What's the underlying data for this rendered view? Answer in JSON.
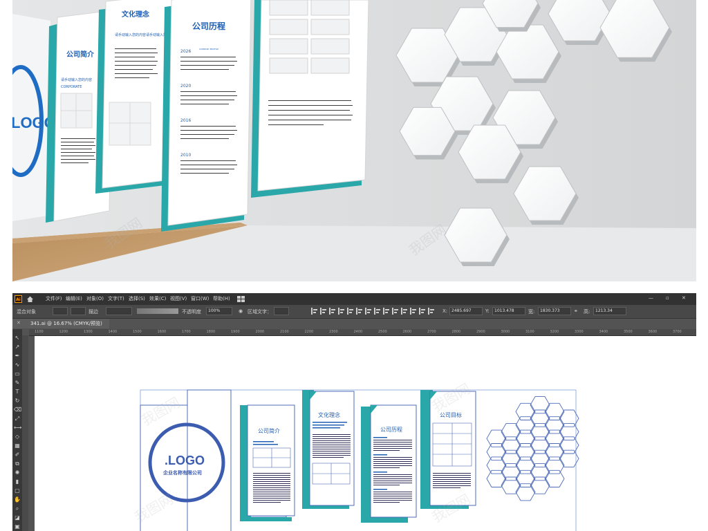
{
  "mockup": {
    "panels": [
      {
        "title": "公司简介",
        "subtitle": "请手动输入您的内容",
        "english": "CORPORATE"
      },
      {
        "title": "文化理念",
        "subtitle": "请手动输入您的内容请手动输入您的内容"
      },
      {
        "title": "公司历程",
        "years": [
          "2026",
          "2020",
          "2016",
          "2010"
        ],
        "year_caption": "COMPANY PROFILE"
      }
    ],
    "logo_text": "LOGO",
    "watermark": "我图网"
  },
  "app": {
    "logo": "Ai",
    "menu": [
      "文件(F)",
      "编辑(E)",
      "对象(O)",
      "文字(T)",
      "选择(S)",
      "效果(C)",
      "视图(V)",
      "窗口(W)",
      "帮助(H)"
    ],
    "control_bar": {
      "mode_label": "混合对象",
      "stroke_label": "描边",
      "opacity_label": "不透明度",
      "opacity_value": "100%",
      "area_text_label": "区域文字：",
      "x_label": "X:",
      "x_value": "2485.697",
      "y_label": "Y:",
      "y_value": "1013.478",
      "w_label": "宽:",
      "w_value": "1830.373",
      "h_label": "高:",
      "h_value": "1213.34"
    },
    "doc_tab": "341.ai @ 16.67% (CMYK/预览)",
    "ruler_ticks": [
      "1100",
      "1200",
      "1300",
      "1400",
      "1500",
      "1600",
      "1700",
      "1800",
      "1900",
      "2000",
      "2100",
      "2200",
      "2300",
      "2400",
      "2500",
      "2600",
      "2700",
      "2800",
      "2900",
      "3000",
      "3100",
      "3200",
      "3300",
      "3400",
      "3500",
      "3600",
      "3700"
    ]
  },
  "artboard": {
    "logo_text": ".LOGO",
    "company_name": "企业名称有限公司",
    "panel_titles": [
      "公司简介",
      "文化理念",
      "公司历程",
      "公司目标"
    ]
  },
  "colors": {
    "teal": "#2aa7a8",
    "blue": "#1f5fb4",
    "outline": "#3e5fb0",
    "ui_dark": "#323232"
  }
}
